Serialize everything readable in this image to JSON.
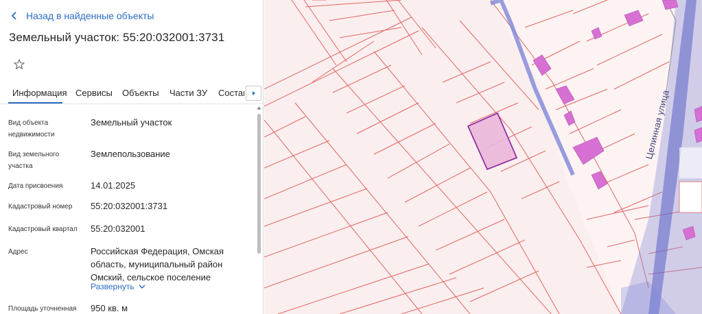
{
  "header": {
    "back_label": "Назад в найденные объекты",
    "title": "Земельный участок: 55:20:032001:3731"
  },
  "tabs": [
    {
      "label": "Информация",
      "active": true
    },
    {
      "label": "Сервисы",
      "active": false
    },
    {
      "label": "Объекты",
      "active": false
    },
    {
      "label": "Части ЗУ",
      "active": false
    },
    {
      "label": "Состав",
      "active": false
    }
  ],
  "info": {
    "object_type_label": "Вид объекта недвижимости",
    "object_type_value": "Земельный участок",
    "land_type_label": "Вид земельного участка",
    "land_type_value": "Землепользование",
    "date_label": "Дата присвоения",
    "date_value": "14.01.2025",
    "cad_number_label": "Кадастровый номер",
    "cad_number_value": "55:20:032001:3731",
    "cad_quarter_label": "Кадастровый квартал",
    "cad_quarter_value": "55:20:032001",
    "address_label": "Адрес",
    "address_value": "Российская Федерация, Омская область, муниципальный район Омский, сельское поселение",
    "expand_label": "Развернуть",
    "area_label": "Площадь уточненная",
    "area_value": "950 кв. м"
  },
  "map": {
    "street_label": "Целинная улица"
  },
  "colors": {
    "accent": "#2a6cc4",
    "parcel_line": "#e06666",
    "selected_fill": "#e9b6d8",
    "selected_stroke": "#8a1f9e",
    "building": "#d770d3",
    "road": "#7e86d8"
  }
}
